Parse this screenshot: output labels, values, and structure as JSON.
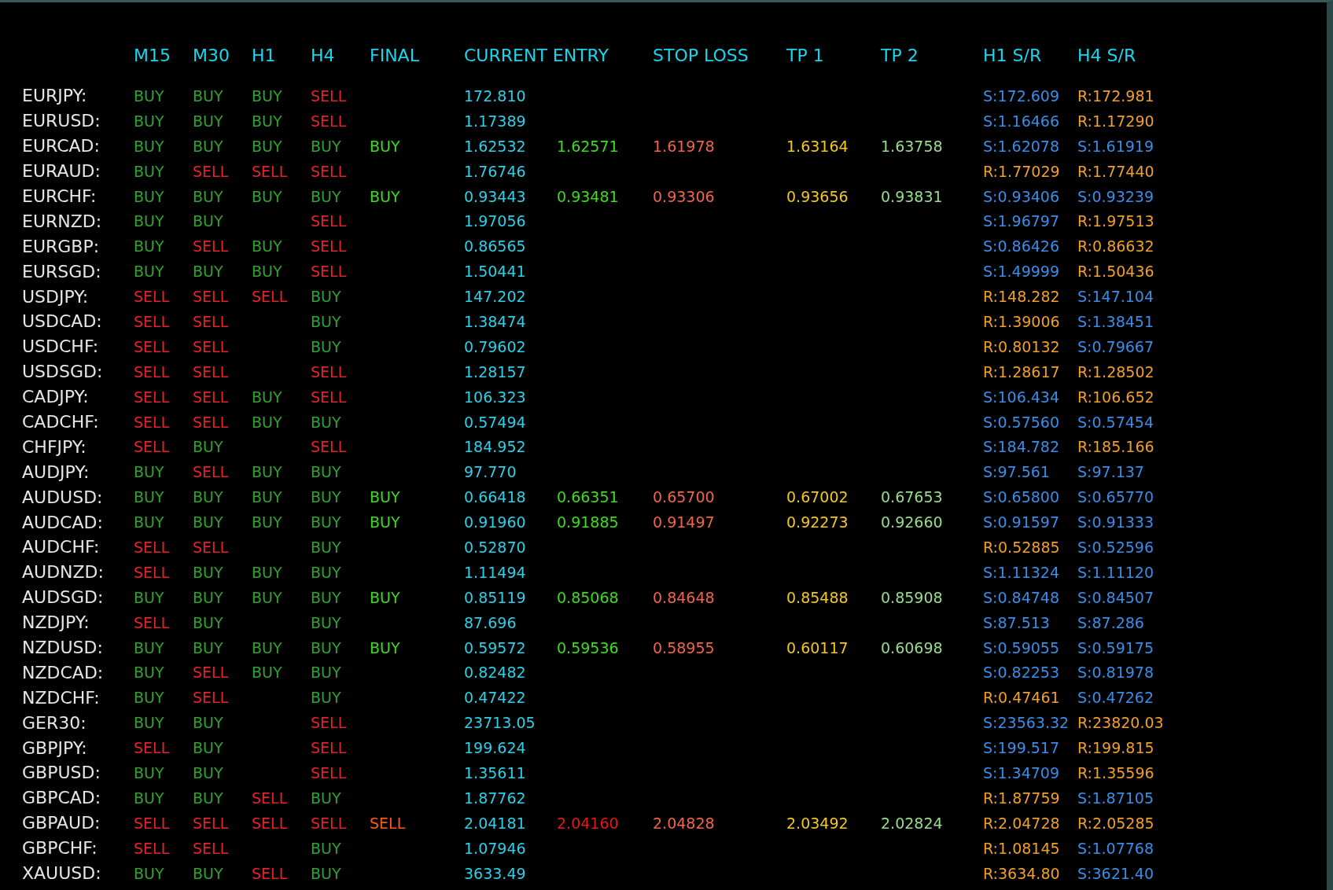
{
  "headers": [
    "M15",
    "M30",
    "H1",
    "H4",
    "FINAL",
    "CURRENT ENTRY",
    "STOP LOSS",
    "TP 1",
    "TP 2",
    "H1 S/R",
    "H4 S/R"
  ],
  "rows": [
    {
      "symbol": "EURJPY:",
      "signals": {
        "m15": {
          "label": "BUY",
          "kind": "buy"
        },
        "m30": {
          "label": "BUY",
          "kind": "buy"
        },
        "h1": {
          "label": "BUY",
          "kind": "buy"
        },
        "h4": {
          "label": "SELL",
          "kind": "sell"
        }
      },
      "current": "172.810",
      "h1_sr": {
        "label": "S:172.609",
        "kind": "support"
      },
      "h4_sr": {
        "label": "R:172.981",
        "kind": "resistance"
      }
    },
    {
      "symbol": "EURUSD:",
      "signals": {
        "m15": {
          "label": "BUY",
          "kind": "buy"
        },
        "m30": {
          "label": "BUY",
          "kind": "buy"
        },
        "h1": {
          "label": "BUY",
          "kind": "buy"
        },
        "h4": {
          "label": "SELL",
          "kind": "sell"
        }
      },
      "current": "1.17389",
      "h1_sr": {
        "label": "S:1.16466",
        "kind": "support"
      },
      "h4_sr": {
        "label": "R:1.17290",
        "kind": "resistance"
      }
    },
    {
      "symbol": "EURCAD:",
      "signals": {
        "m15": {
          "label": "BUY",
          "kind": "buy"
        },
        "m30": {
          "label": "BUY",
          "kind": "buy"
        },
        "h1": {
          "label": "BUY",
          "kind": "buy"
        },
        "h4": {
          "label": "BUY",
          "kind": "buy"
        }
      },
      "final": {
        "label": "BUY",
        "kind": "buy"
      },
      "current": "1.62532",
      "entry": "1.62571",
      "stop_loss": "1.61978",
      "tp1": "1.63164",
      "tp2": "1.63758",
      "h1_sr": {
        "label": "S:1.62078",
        "kind": "support"
      },
      "h4_sr": {
        "label": "S:1.61919",
        "kind": "support"
      }
    },
    {
      "symbol": "EURAUD:",
      "signals": {
        "m15": {
          "label": "BUY",
          "kind": "buy"
        },
        "m30": {
          "label": "SELL",
          "kind": "sell"
        },
        "h1": {
          "label": "SELL",
          "kind": "sell"
        },
        "h4": {
          "label": "SELL",
          "kind": "sell"
        }
      },
      "current": "1.76746",
      "h1_sr": {
        "label": "R:1.77029",
        "kind": "resistance"
      },
      "h4_sr": {
        "label": "R:1.77440",
        "kind": "resistance"
      }
    },
    {
      "symbol": "EURCHF:",
      "signals": {
        "m15": {
          "label": "BUY",
          "kind": "buy"
        },
        "m30": {
          "label": "BUY",
          "kind": "buy"
        },
        "h1": {
          "label": "BUY",
          "kind": "buy"
        },
        "h4": {
          "label": "BUY",
          "kind": "buy"
        }
      },
      "final": {
        "label": "BUY",
        "kind": "buy"
      },
      "current": "0.93443",
      "entry": "0.93481",
      "stop_loss": "0.93306",
      "tp1": "0.93656",
      "tp2": "0.93831",
      "h1_sr": {
        "label": "S:0.93406",
        "kind": "support"
      },
      "h4_sr": {
        "label": "S:0.93239",
        "kind": "support"
      }
    },
    {
      "symbol": "EURNZD:",
      "signals": {
        "m15": {
          "label": "BUY",
          "kind": "buy"
        },
        "m30": {
          "label": "BUY",
          "kind": "buy"
        },
        "h4": {
          "label": "SELL",
          "kind": "sell"
        }
      },
      "current": "1.97056",
      "h1_sr": {
        "label": "S:1.96797",
        "kind": "support"
      },
      "h4_sr": {
        "label": "R:1.97513",
        "kind": "resistance"
      }
    },
    {
      "symbol": "EURGBP:",
      "signals": {
        "m15": {
          "label": "BUY",
          "kind": "buy"
        },
        "m30": {
          "label": "SELL",
          "kind": "sell"
        },
        "h1": {
          "label": "BUY",
          "kind": "buy"
        },
        "h4": {
          "label": "SELL",
          "kind": "sell"
        }
      },
      "current": "0.86565",
      "h1_sr": {
        "label": "S:0.86426",
        "kind": "support"
      },
      "h4_sr": {
        "label": "R:0.86632",
        "kind": "resistance"
      }
    },
    {
      "symbol": "EURSGD:",
      "signals": {
        "m15": {
          "label": "BUY",
          "kind": "buy"
        },
        "m30": {
          "label": "BUY",
          "kind": "buy"
        },
        "h1": {
          "label": "BUY",
          "kind": "buy"
        },
        "h4": {
          "label": "SELL",
          "kind": "sell"
        }
      },
      "current": "1.50441",
      "h1_sr": {
        "label": "S:1.49999",
        "kind": "support"
      },
      "h4_sr": {
        "label": "R:1.50436",
        "kind": "resistance"
      }
    },
    {
      "symbol": "USDJPY:",
      "signals": {
        "m15": {
          "label": "SELL",
          "kind": "sell"
        },
        "m30": {
          "label": "SELL",
          "kind": "sell"
        },
        "h1": {
          "label": "SELL",
          "kind": "sell"
        },
        "h4": {
          "label": "BUY",
          "kind": "buy"
        }
      },
      "current": "147.202",
      "h1_sr": {
        "label": "R:148.282",
        "kind": "resistance"
      },
      "h4_sr": {
        "label": "S:147.104",
        "kind": "support"
      }
    },
    {
      "symbol": "USDCAD:",
      "signals": {
        "m15": {
          "label": "SELL",
          "kind": "sell"
        },
        "m30": {
          "label": "SELL",
          "kind": "sell"
        },
        "h4": {
          "label": "BUY",
          "kind": "buy"
        }
      },
      "current": "1.38474",
      "h1_sr": {
        "label": "R:1.39006",
        "kind": "resistance"
      },
      "h4_sr": {
        "label": "S:1.38451",
        "kind": "support"
      }
    },
    {
      "symbol": "USDCHF:",
      "signals": {
        "m15": {
          "label": "SELL",
          "kind": "sell"
        },
        "m30": {
          "label": "SELL",
          "kind": "sell"
        },
        "h4": {
          "label": "BUY",
          "kind": "buy"
        }
      },
      "current": "0.79602",
      "h1_sr": {
        "label": "R:0.80132",
        "kind": "resistance"
      },
      "h4_sr": {
        "label": "S:0.79667",
        "kind": "support"
      }
    },
    {
      "symbol": "USDSGD:",
      "signals": {
        "m15": {
          "label": "SELL",
          "kind": "sell"
        },
        "m30": {
          "label": "SELL",
          "kind": "sell"
        },
        "h4": {
          "label": "SELL",
          "kind": "sell"
        }
      },
      "current": "1.28157",
      "h1_sr": {
        "label": "R:1.28617",
        "kind": "resistance"
      },
      "h4_sr": {
        "label": "R:1.28502",
        "kind": "resistance"
      }
    },
    {
      "symbol": "CADJPY:",
      "signals": {
        "m15": {
          "label": "SELL",
          "kind": "sell"
        },
        "m30": {
          "label": "SELL",
          "kind": "sell"
        },
        "h1": {
          "label": "BUY",
          "kind": "buy"
        },
        "h4": {
          "label": "SELL",
          "kind": "sell"
        }
      },
      "current": "106.323",
      "h1_sr": {
        "label": "S:106.434",
        "kind": "support"
      },
      "h4_sr": {
        "label": "R:106.652",
        "kind": "resistance"
      }
    },
    {
      "symbol": "CADCHF:",
      "signals": {
        "m15": {
          "label": "SELL",
          "kind": "sell"
        },
        "m30": {
          "label": "SELL",
          "kind": "sell"
        },
        "h1": {
          "label": "BUY",
          "kind": "buy"
        },
        "h4": {
          "label": "BUY",
          "kind": "buy"
        }
      },
      "current": "0.57494",
      "h1_sr": {
        "label": "S:0.57560",
        "kind": "support"
      },
      "h4_sr": {
        "label": "S:0.57454",
        "kind": "support"
      }
    },
    {
      "symbol": "CHFJPY:",
      "signals": {
        "m15": {
          "label": "SELL",
          "kind": "sell"
        },
        "m30": {
          "label": "BUY",
          "kind": "buy"
        },
        "h4": {
          "label": "SELL",
          "kind": "sell"
        }
      },
      "current": "184.952",
      "h1_sr": {
        "label": "S:184.782",
        "kind": "support"
      },
      "h4_sr": {
        "label": "R:185.166",
        "kind": "resistance"
      }
    },
    {
      "symbol": "AUDJPY:",
      "signals": {
        "m15": {
          "label": "BUY",
          "kind": "buy"
        },
        "m30": {
          "label": "SELL",
          "kind": "sell"
        },
        "h1": {
          "label": "BUY",
          "kind": "buy"
        },
        "h4": {
          "label": "BUY",
          "kind": "buy"
        }
      },
      "current": "97.770",
      "h1_sr": {
        "label": "S:97.561",
        "kind": "support"
      },
      "h4_sr": {
        "label": "S:97.137",
        "kind": "support"
      }
    },
    {
      "symbol": "AUDUSD:",
      "signals": {
        "m15": {
          "label": "BUY",
          "kind": "buy"
        },
        "m30": {
          "label": "BUY",
          "kind": "buy"
        },
        "h1": {
          "label": "BUY",
          "kind": "buy"
        },
        "h4": {
          "label": "BUY",
          "kind": "buy"
        }
      },
      "final": {
        "label": "BUY",
        "kind": "buy"
      },
      "current": "0.66418",
      "entry": "0.66351",
      "stop_loss": "0.65700",
      "tp1": "0.67002",
      "tp2": "0.67653",
      "h1_sr": {
        "label": "S:0.65800",
        "kind": "support"
      },
      "h4_sr": {
        "label": "S:0.65770",
        "kind": "support"
      }
    },
    {
      "symbol": "AUDCAD:",
      "signals": {
        "m15": {
          "label": "BUY",
          "kind": "buy"
        },
        "m30": {
          "label": "BUY",
          "kind": "buy"
        },
        "h1": {
          "label": "BUY",
          "kind": "buy"
        },
        "h4": {
          "label": "BUY",
          "kind": "buy"
        }
      },
      "final": {
        "label": "BUY",
        "kind": "buy"
      },
      "current": "0.91960",
      "entry": "0.91885",
      "stop_loss": "0.91497",
      "tp1": "0.92273",
      "tp2": "0.92660",
      "h1_sr": {
        "label": "S:0.91597",
        "kind": "support"
      },
      "h4_sr": {
        "label": "S:0.91333",
        "kind": "support"
      }
    },
    {
      "symbol": "AUDCHF:",
      "signals": {
        "m15": {
          "label": "SELL",
          "kind": "sell"
        },
        "m30": {
          "label": "SELL",
          "kind": "sell"
        },
        "h4": {
          "label": "BUY",
          "kind": "buy"
        }
      },
      "current": "0.52870",
      "h1_sr": {
        "label": "R:0.52885",
        "kind": "resistance"
      },
      "h4_sr": {
        "label": "S:0.52596",
        "kind": "support"
      }
    },
    {
      "symbol": "AUDNZD:",
      "signals": {
        "m15": {
          "label": "SELL",
          "kind": "sell"
        },
        "m30": {
          "label": "BUY",
          "kind": "buy"
        },
        "h1": {
          "label": "BUY",
          "kind": "buy"
        },
        "h4": {
          "label": "BUY",
          "kind": "buy"
        }
      },
      "current": "1.11494",
      "h1_sr": {
        "label": "S:1.11324",
        "kind": "support"
      },
      "h4_sr": {
        "label": "S:1.11120",
        "kind": "support"
      }
    },
    {
      "symbol": "AUDSGD:",
      "signals": {
        "m15": {
          "label": "BUY",
          "kind": "buy"
        },
        "m30": {
          "label": "BUY",
          "kind": "buy"
        },
        "h1": {
          "label": "BUY",
          "kind": "buy"
        },
        "h4": {
          "label": "BUY",
          "kind": "buy"
        }
      },
      "final": {
        "label": "BUY",
        "kind": "buy"
      },
      "current": "0.85119",
      "entry": "0.85068",
      "stop_loss": "0.84648",
      "tp1": "0.85488",
      "tp2": "0.85908",
      "h1_sr": {
        "label": "S:0.84748",
        "kind": "support"
      },
      "h4_sr": {
        "label": "S:0.84507",
        "kind": "support"
      }
    },
    {
      "symbol": "NZDJPY:",
      "signals": {
        "m15": {
          "label": "SELL",
          "kind": "sell"
        },
        "m30": {
          "label": "BUY",
          "kind": "buy"
        },
        "h4": {
          "label": "BUY",
          "kind": "buy"
        }
      },
      "current": "87.696",
      "h1_sr": {
        "label": "S:87.513",
        "kind": "support"
      },
      "h4_sr": {
        "label": "S:87.286",
        "kind": "support"
      }
    },
    {
      "symbol": "NZDUSD:",
      "signals": {
        "m15": {
          "label": "BUY",
          "kind": "buy"
        },
        "m30": {
          "label": "BUY",
          "kind": "buy"
        },
        "h1": {
          "label": "BUY",
          "kind": "buy"
        },
        "h4": {
          "label": "BUY",
          "kind": "buy"
        }
      },
      "final": {
        "label": "BUY",
        "kind": "buy"
      },
      "current": "0.59572",
      "entry": "0.59536",
      "stop_loss": "0.58955",
      "tp1": "0.60117",
      "tp2": "0.60698",
      "h1_sr": {
        "label": "S:0.59055",
        "kind": "support"
      },
      "h4_sr": {
        "label": "S:0.59175",
        "kind": "support"
      }
    },
    {
      "symbol": "NZDCAD:",
      "signals": {
        "m15": {
          "label": "BUY",
          "kind": "buy"
        },
        "m30": {
          "label": "SELL",
          "kind": "sell"
        },
        "h1": {
          "label": "BUY",
          "kind": "buy"
        },
        "h4": {
          "label": "BUY",
          "kind": "buy"
        }
      },
      "current": "0.82482",
      "h1_sr": {
        "label": "S:0.82253",
        "kind": "support"
      },
      "h4_sr": {
        "label": "S:0.81978",
        "kind": "support"
      }
    },
    {
      "symbol": "NZDCHF:",
      "signals": {
        "m15": {
          "label": "BUY",
          "kind": "buy"
        },
        "m30": {
          "label": "SELL",
          "kind": "sell"
        },
        "h4": {
          "label": "BUY",
          "kind": "buy"
        }
      },
      "current": "0.47422",
      "h1_sr": {
        "label": "R:0.47461",
        "kind": "resistance"
      },
      "h4_sr": {
        "label": "S:0.47262",
        "kind": "support"
      }
    },
    {
      "symbol": "GER30:",
      "signals": {
        "m15": {
          "label": "BUY",
          "kind": "buy"
        },
        "m30": {
          "label": "BUY",
          "kind": "buy"
        },
        "h4": {
          "label": "SELL",
          "kind": "sell"
        }
      },
      "current": "23713.05",
      "h1_sr": {
        "label": "S:23563.32",
        "kind": "support"
      },
      "h4_sr": {
        "label": "R:23820.03",
        "kind": "resistance"
      }
    },
    {
      "symbol": "GBPJPY:",
      "signals": {
        "m15": {
          "label": "SELL",
          "kind": "sell"
        },
        "m30": {
          "label": "BUY",
          "kind": "buy"
        },
        "h4": {
          "label": "SELL",
          "kind": "sell"
        }
      },
      "current": "199.624",
      "h1_sr": {
        "label": "S:199.517",
        "kind": "support"
      },
      "h4_sr": {
        "label": "R:199.815",
        "kind": "resistance"
      }
    },
    {
      "symbol": "GBPUSD:",
      "signals": {
        "m15": {
          "label": "BUY",
          "kind": "buy"
        },
        "m30": {
          "label": "BUY",
          "kind": "buy"
        },
        "h4": {
          "label": "SELL",
          "kind": "sell"
        }
      },
      "current": "1.35611",
      "h1_sr": {
        "label": "S:1.34709",
        "kind": "support"
      },
      "h4_sr": {
        "label": "R:1.35596",
        "kind": "resistance"
      }
    },
    {
      "symbol": "GBPCAD:",
      "signals": {
        "m15": {
          "label": "BUY",
          "kind": "buy"
        },
        "m30": {
          "label": "BUY",
          "kind": "buy"
        },
        "h1": {
          "label": "SELL",
          "kind": "sell"
        },
        "h4": {
          "label": "BUY",
          "kind": "buy"
        }
      },
      "current": "1.87762",
      "h1_sr": {
        "label": "R:1.87759",
        "kind": "resistance"
      },
      "h4_sr": {
        "label": "S:1.87105",
        "kind": "support"
      }
    },
    {
      "symbol": "GBPAUD:",
      "signals": {
        "m15": {
          "label": "SELL",
          "kind": "sell"
        },
        "m30": {
          "label": "SELL",
          "kind": "sell"
        },
        "h1": {
          "label": "SELL",
          "kind": "sell"
        },
        "h4": {
          "label": "SELL",
          "kind": "sell"
        }
      },
      "final": {
        "label": "SELL",
        "kind": "sell"
      },
      "current": "2.04181",
      "entry": "2.04160",
      "stop_loss": "2.04828",
      "tp1": "2.03492",
      "tp2": "2.02824",
      "h1_sr": {
        "label": "R:2.04728",
        "kind": "resistance"
      },
      "h4_sr": {
        "label": "R:2.05285",
        "kind": "resistance"
      }
    },
    {
      "symbol": "GBPCHF:",
      "signals": {
        "m15": {
          "label": "SELL",
          "kind": "sell"
        },
        "m30": {
          "label": "SELL",
          "kind": "sell"
        },
        "h4": {
          "label": "BUY",
          "kind": "buy"
        }
      },
      "current": "1.07946",
      "h1_sr": {
        "label": "R:1.08145",
        "kind": "resistance"
      },
      "h4_sr": {
        "label": "S:1.07768",
        "kind": "support"
      }
    },
    {
      "symbol": "XAUUSD:",
      "signals": {
        "m15": {
          "label": "BUY",
          "kind": "buy"
        },
        "m30": {
          "label": "BUY",
          "kind": "buy"
        },
        "h1": {
          "label": "SELL",
          "kind": "sell"
        },
        "h4": {
          "label": "BUY",
          "kind": "buy"
        }
      },
      "current": "3633.49",
      "h1_sr": {
        "label": "R:3634.80",
        "kind": "resistance"
      },
      "h4_sr": {
        "label": "S:3621.40",
        "kind": "support"
      }
    }
  ]
}
